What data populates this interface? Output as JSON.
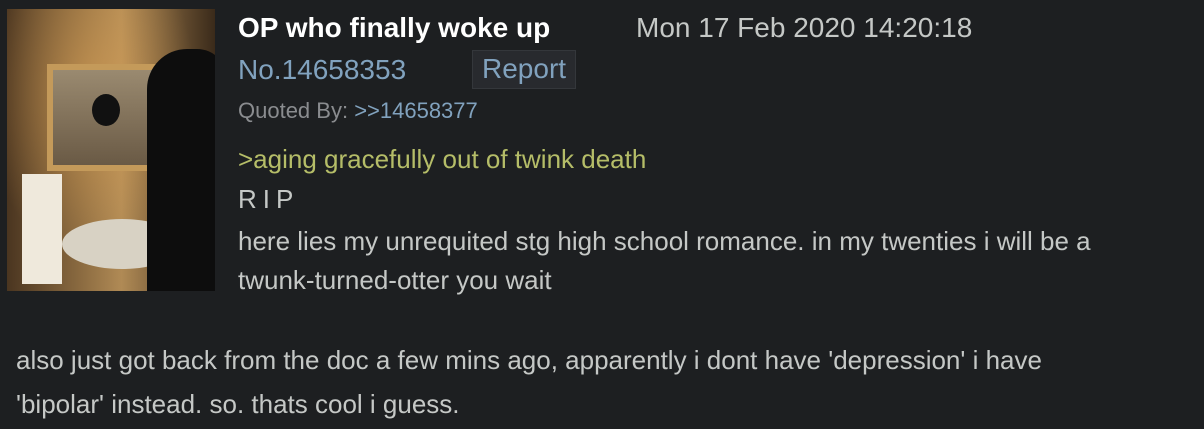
{
  "post": {
    "name": "OP who finally woke up",
    "date": "Mon 17 Feb 2020 14:20:18",
    "number": "No.14658353",
    "report_label": "Report",
    "quoted_by_label": "Quoted By: ",
    "quoted_by_link": ">>14658377",
    "body": {
      "greentext": ">aging gracefully out of twink death",
      "line_rip": "RIP",
      "line_1": "here lies my unrequited stg high school romance. in my twenties i will be a",
      "line_2": "twunk-turned-otter you wait",
      "line_3": "also just got back from the doc a few mins ago, apparently i dont have 'depression' i have",
      "line_4": "'bipolar' instead. so. thats cool i guess."
    }
  },
  "colors": {
    "background": "#1d1f21",
    "text": "#c5c8c6",
    "name": "#ffffff",
    "link": "#81a2be",
    "greentext": "#b5bd68",
    "muted": "#8a8c8f"
  }
}
